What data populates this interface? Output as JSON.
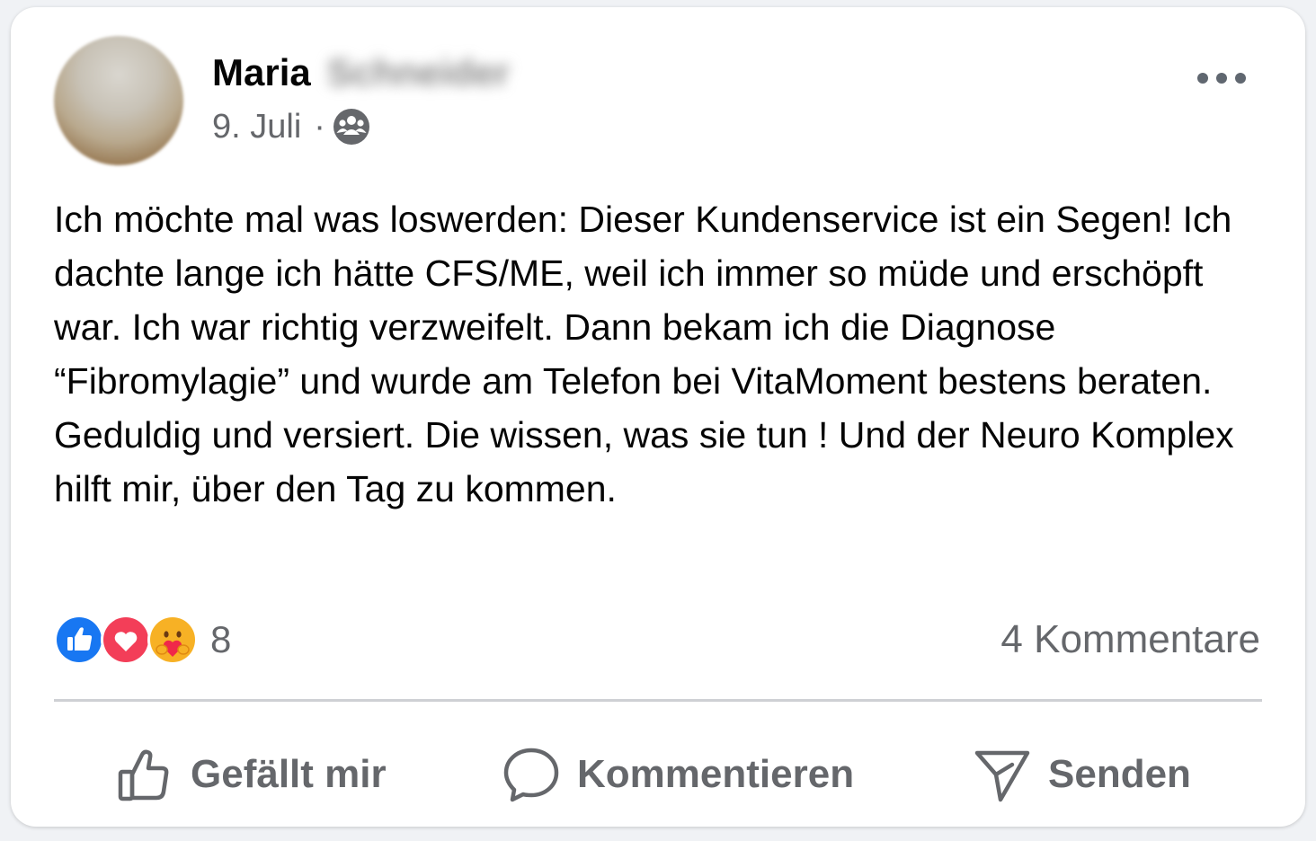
{
  "post": {
    "author_first": "Maria",
    "author_last": "Schneider",
    "date": "9. Juli",
    "separator": "·",
    "audience_icon": "group-icon",
    "text": "Ich möchte mal was loswerden: Dieser Kundenservice ist ein Segen! Ich dachte lange ich hätte CFS/ME, weil ich immer so müde und erschöpft war. Ich war richtig verzweifelt. Dann bekam ich die Diagnose “Fibromylagie” und wurde am Telefon bei VitaMoment bestens beraten. Geduldig und versiert. Die wissen, was sie tun ! Und der Neuro Komplex hilft mir, über den Tag zu kommen."
  },
  "stats": {
    "reaction_icons": [
      "like-icon",
      "love-icon",
      "care-icon"
    ],
    "reaction_count": "8",
    "comments_label": "4 Kommentare"
  },
  "actions": {
    "like_label": "Gefällt mir",
    "comment_label": "Kommentieren",
    "send_label": "Senden"
  },
  "colors": {
    "like_blue": "#1877f2",
    "love_red": "#f33e58",
    "care_yellow": "#f7b125",
    "secondary_text": "#65676b"
  }
}
